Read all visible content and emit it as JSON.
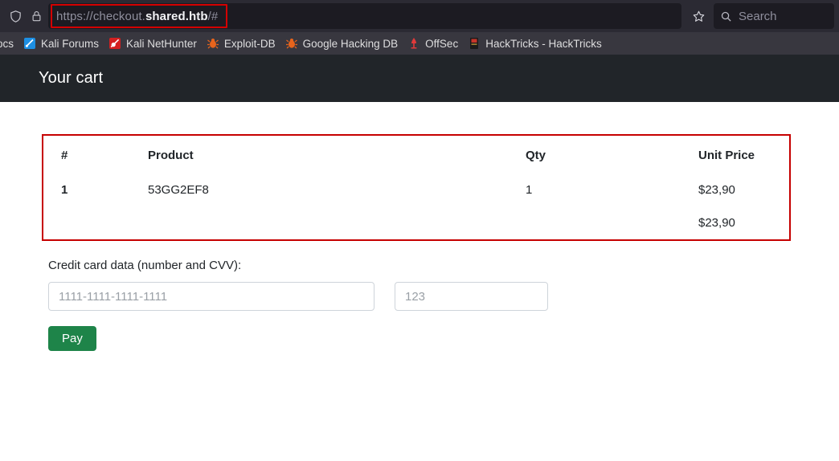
{
  "browser": {
    "url_prefix": "https://checkout.",
    "url_host": "shared.htb",
    "url_suffix": "/#",
    "shield_icon": "shield-icon",
    "lock_icon": "padlock-icon",
    "star_icon": "star-icon",
    "search_icon": "search-icon",
    "search_placeholder": "Search",
    "annotation_color": "#d40000",
    "bookmarks": [
      {
        "label": "ocs",
        "icon": "kali-docs-icon"
      },
      {
        "label": "Kali Forums",
        "icon": "kali-forums-icon"
      },
      {
        "label": "Kali NetHunter",
        "icon": "kali-nethunter-icon"
      },
      {
        "label": "Exploit-DB",
        "icon": "exploit-db-bug-icon"
      },
      {
        "label": "Google Hacking DB",
        "icon": "google-hacking-db-bug-icon"
      },
      {
        "label": "OffSec",
        "icon": "offsec-icon"
      },
      {
        "label": "HackTricks - HackTricks",
        "icon": "hacktricks-icon"
      }
    ]
  },
  "site": {
    "title": "Your cart",
    "navbar_color": "#212529"
  },
  "cart": {
    "annotation_color": "#c60000",
    "headers": {
      "num": "#",
      "product": "Product",
      "qty": "Qty",
      "unit_price": "Unit Price"
    },
    "rows": [
      {
        "num": "1",
        "product": "53GG2EF8",
        "qty": "1",
        "unit_price": "$23,90"
      }
    ],
    "total": "$23,90"
  },
  "form": {
    "label": "Credit card data (number and CVV):",
    "card_number_value": "",
    "card_number_placeholder": "1111-1111-1111-1111",
    "cvv_value": "",
    "cvv_placeholder": "123",
    "pay_label": "Pay",
    "pay_color": "#1e8449"
  }
}
